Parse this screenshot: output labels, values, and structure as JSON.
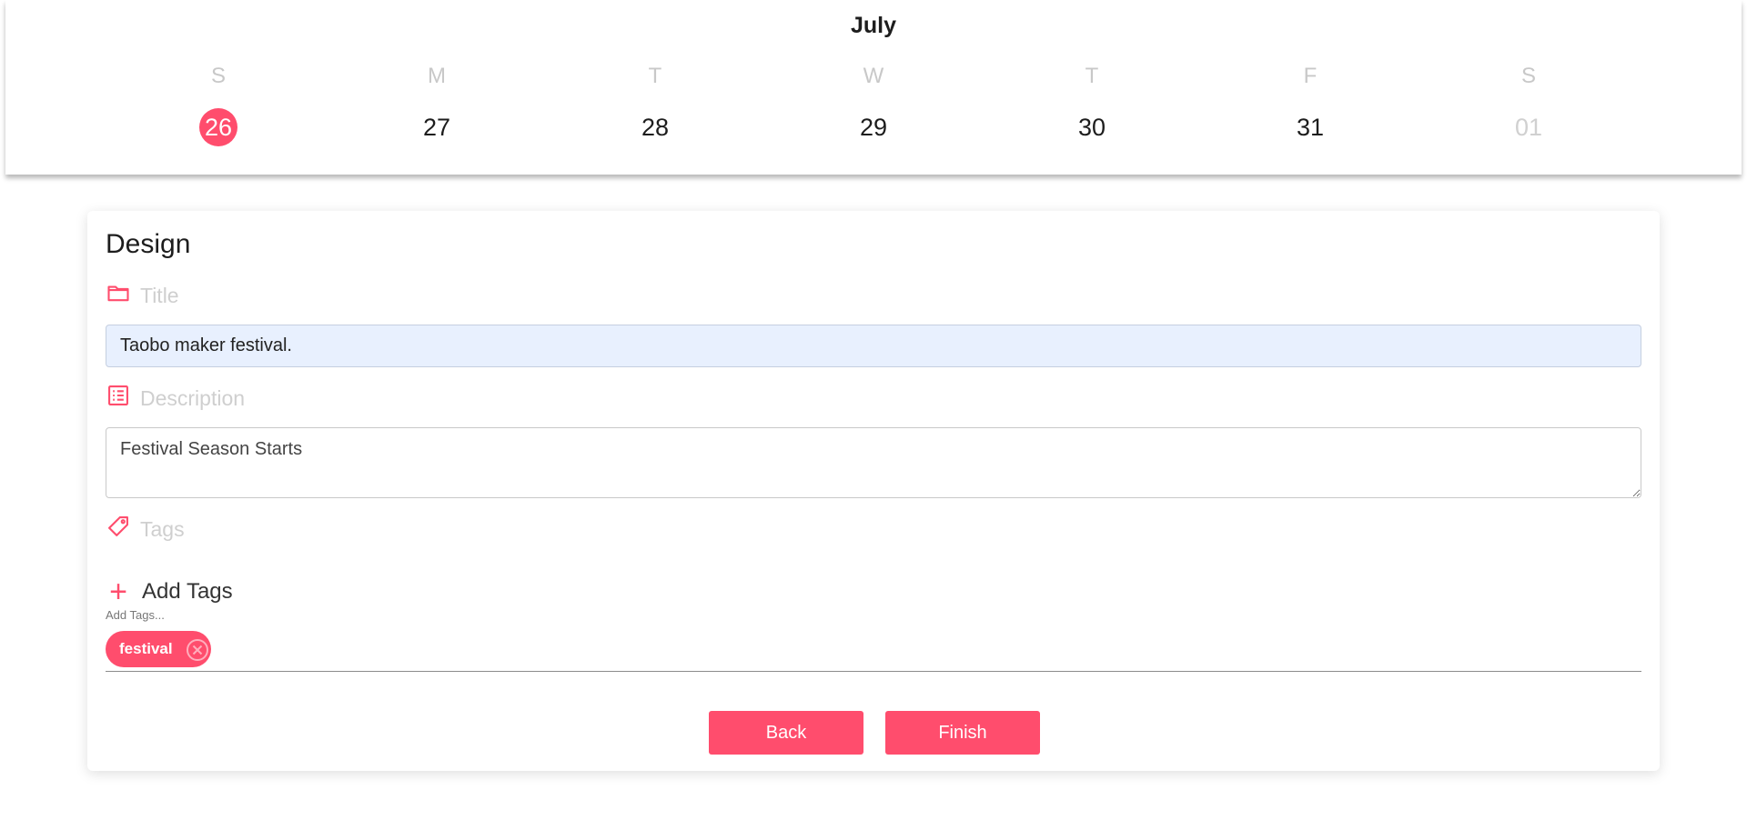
{
  "calendar": {
    "month": "July",
    "days": [
      {
        "dow": "S",
        "date": "26",
        "state": "selected"
      },
      {
        "dow": "M",
        "date": "27",
        "state": "normal"
      },
      {
        "dow": "T",
        "date": "28",
        "state": "normal"
      },
      {
        "dow": "W",
        "date": "29",
        "state": "normal"
      },
      {
        "dow": "T",
        "date": "30",
        "state": "normal"
      },
      {
        "dow": "F",
        "date": "31",
        "state": "normal"
      },
      {
        "dow": "S",
        "date": "01",
        "state": "muted"
      }
    ]
  },
  "form": {
    "heading": "Design",
    "title_label": "Title",
    "title_value": "Taobo maker festival.",
    "description_label": "Description",
    "description_value": "Festival Season Starts",
    "tags_label": "Tags",
    "add_tags_label": "Add Tags",
    "tags_input_hint": "Add Tags...",
    "tags": [
      "festival"
    ],
    "back_label": "Back",
    "finish_label": "Finish"
  },
  "colors": {
    "accent": "#ff4d6d",
    "title_input_bg": "#e8f0fe",
    "muted_text": "#cfcfcf"
  },
  "icons": {
    "title": "folder-icon",
    "description": "list-icon",
    "tags": "tag-icon",
    "add": "plus-icon",
    "remove_tag": "close-circle-icon"
  }
}
